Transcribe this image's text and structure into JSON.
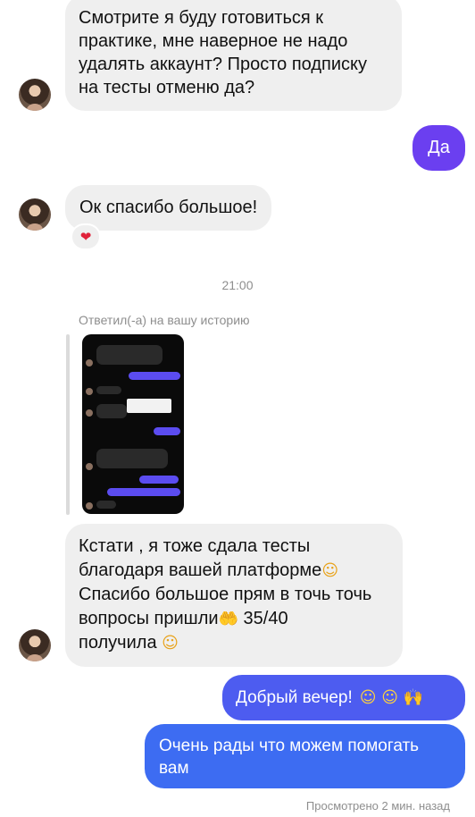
{
  "messages": {
    "m1": {
      "lines": [
        "Смотрите я буду готовиться к",
        "практике, мне наверное не надо",
        "удалять аккаунт? Просто подписку",
        "на тесты отменю да?"
      ]
    },
    "m2": {
      "text": "Да"
    },
    "m3": {
      "text": "Ок спасибо большое!",
      "reaction": "heart-emoji"
    },
    "time": "21:00",
    "replied_label": "Ответил(-а) на вашу историю",
    "m4": {
      "lines": [
        "Кстати , я тоже сдала тесты",
        "благодаря вашей платформе",
        "Спасибо большое прям в точь точь",
        "вопросы пришли",
        "получила"
      ],
      "line4_suffix": "35/40",
      "emoji_line2": "☺",
      "emoji_line4": "🤲",
      "emoji_line5": "☺"
    },
    "m5": {
      "text": "Добрый вечер!",
      "emoji": "☺ ☺ 🙌"
    },
    "m6": {
      "lines": [
        "Очень рады что можем помогать",
        "вам"
      ]
    },
    "seen": "Просмотрено 2 мин. назад"
  },
  "colors": {
    "incoming_bubble": "#efefef",
    "outgoing_purple": "#6b3ff0",
    "outgoing_violet": "#4d5cf0",
    "outgoing_blue": "#3d6cf2"
  }
}
